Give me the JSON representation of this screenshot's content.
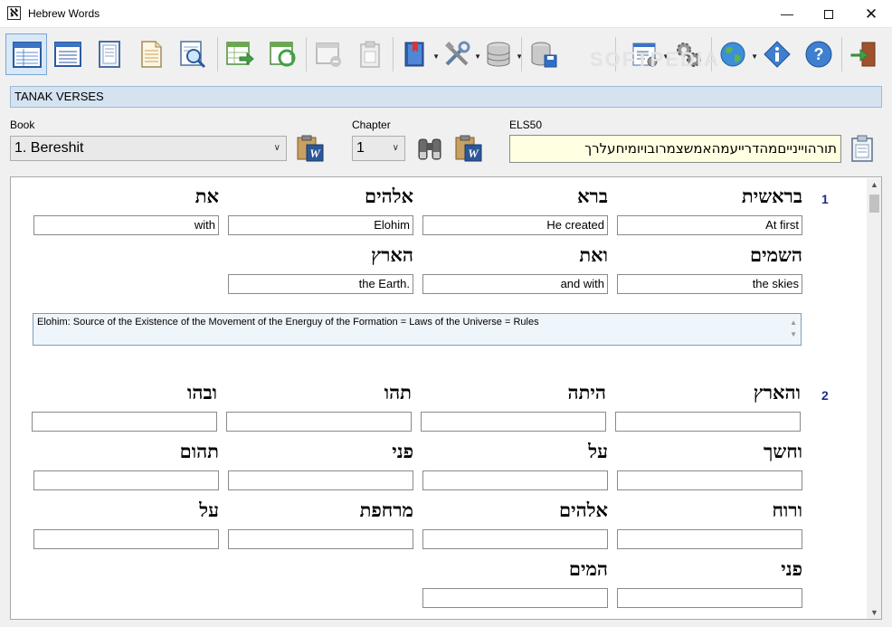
{
  "window": {
    "title": "Hebrew Words",
    "app_icon_glyph": "ℵ",
    "controls": {
      "minimize": "—",
      "maximize": "",
      "close": "✕"
    }
  },
  "toolbar": {
    "icons": [
      "table-view-icon",
      "list-view-icon",
      "page-view-icon",
      "document-icon",
      "search-document-icon",
      "export-table-icon",
      "refresh-table-icon",
      "window-disabled-icon",
      "clipboard-disabled-icon",
      "bookmark-icon",
      "tools-icon",
      "database-icon",
      "database-save-icon",
      "settings-list-icon",
      "gears-icon",
      "globe-icon",
      "info-icon",
      "help-icon",
      "exit-icon"
    ],
    "watermark": "SOFTPEDIA"
  },
  "header": {
    "band_title": "TANAK VERSES"
  },
  "selectors": {
    "book_label": "Book",
    "book_value": "1. Bereshit",
    "chapter_label": "Chapter",
    "chapter_value": "1",
    "els_label": "ELS50",
    "els_value": "תורהויינייםמהדרייעמהאמשצמרובויומיחעלרך"
  },
  "verses": [
    {
      "number": "1",
      "rows": [
        [
          {
            "hebrew": "בראשית",
            "translation": "At first"
          },
          {
            "hebrew": "ברא",
            "translation": "He created"
          },
          {
            "hebrew": "אלהים",
            "translation": "Elohim"
          },
          {
            "hebrew": "את",
            "translation": "with"
          }
        ],
        [
          {
            "hebrew": "השמים",
            "translation": "the skies"
          },
          {
            "hebrew": "ואת",
            "translation": "and with"
          },
          {
            "hebrew": "הארץ",
            "translation": "the Earth."
          }
        ]
      ],
      "note": "Elohim: Source of the Existence of the Movement of the Energuy of the Formation = Laws of the Universe = Rules"
    },
    {
      "number": "2",
      "rows": [
        [
          {
            "hebrew": "והארץ",
            "translation": ""
          },
          {
            "hebrew": "היתה",
            "translation": ""
          },
          {
            "hebrew": "תהו",
            "translation": ""
          },
          {
            "hebrew": "ובהו",
            "translation": ""
          }
        ],
        [
          {
            "hebrew": "וחשך",
            "translation": ""
          },
          {
            "hebrew": "על",
            "translation": ""
          },
          {
            "hebrew": "פני",
            "translation": ""
          },
          {
            "hebrew": "תהום",
            "translation": ""
          }
        ],
        [
          {
            "hebrew": "ורוח",
            "translation": ""
          },
          {
            "hebrew": "אלהים",
            "translation": ""
          },
          {
            "hebrew": "מרחפת",
            "translation": ""
          },
          {
            "hebrew": "על",
            "translation": ""
          }
        ],
        [
          {
            "hebrew": "פני",
            "translation": ""
          },
          {
            "hebrew": "המים",
            "translation": ""
          }
        ]
      ]
    }
  ]
}
